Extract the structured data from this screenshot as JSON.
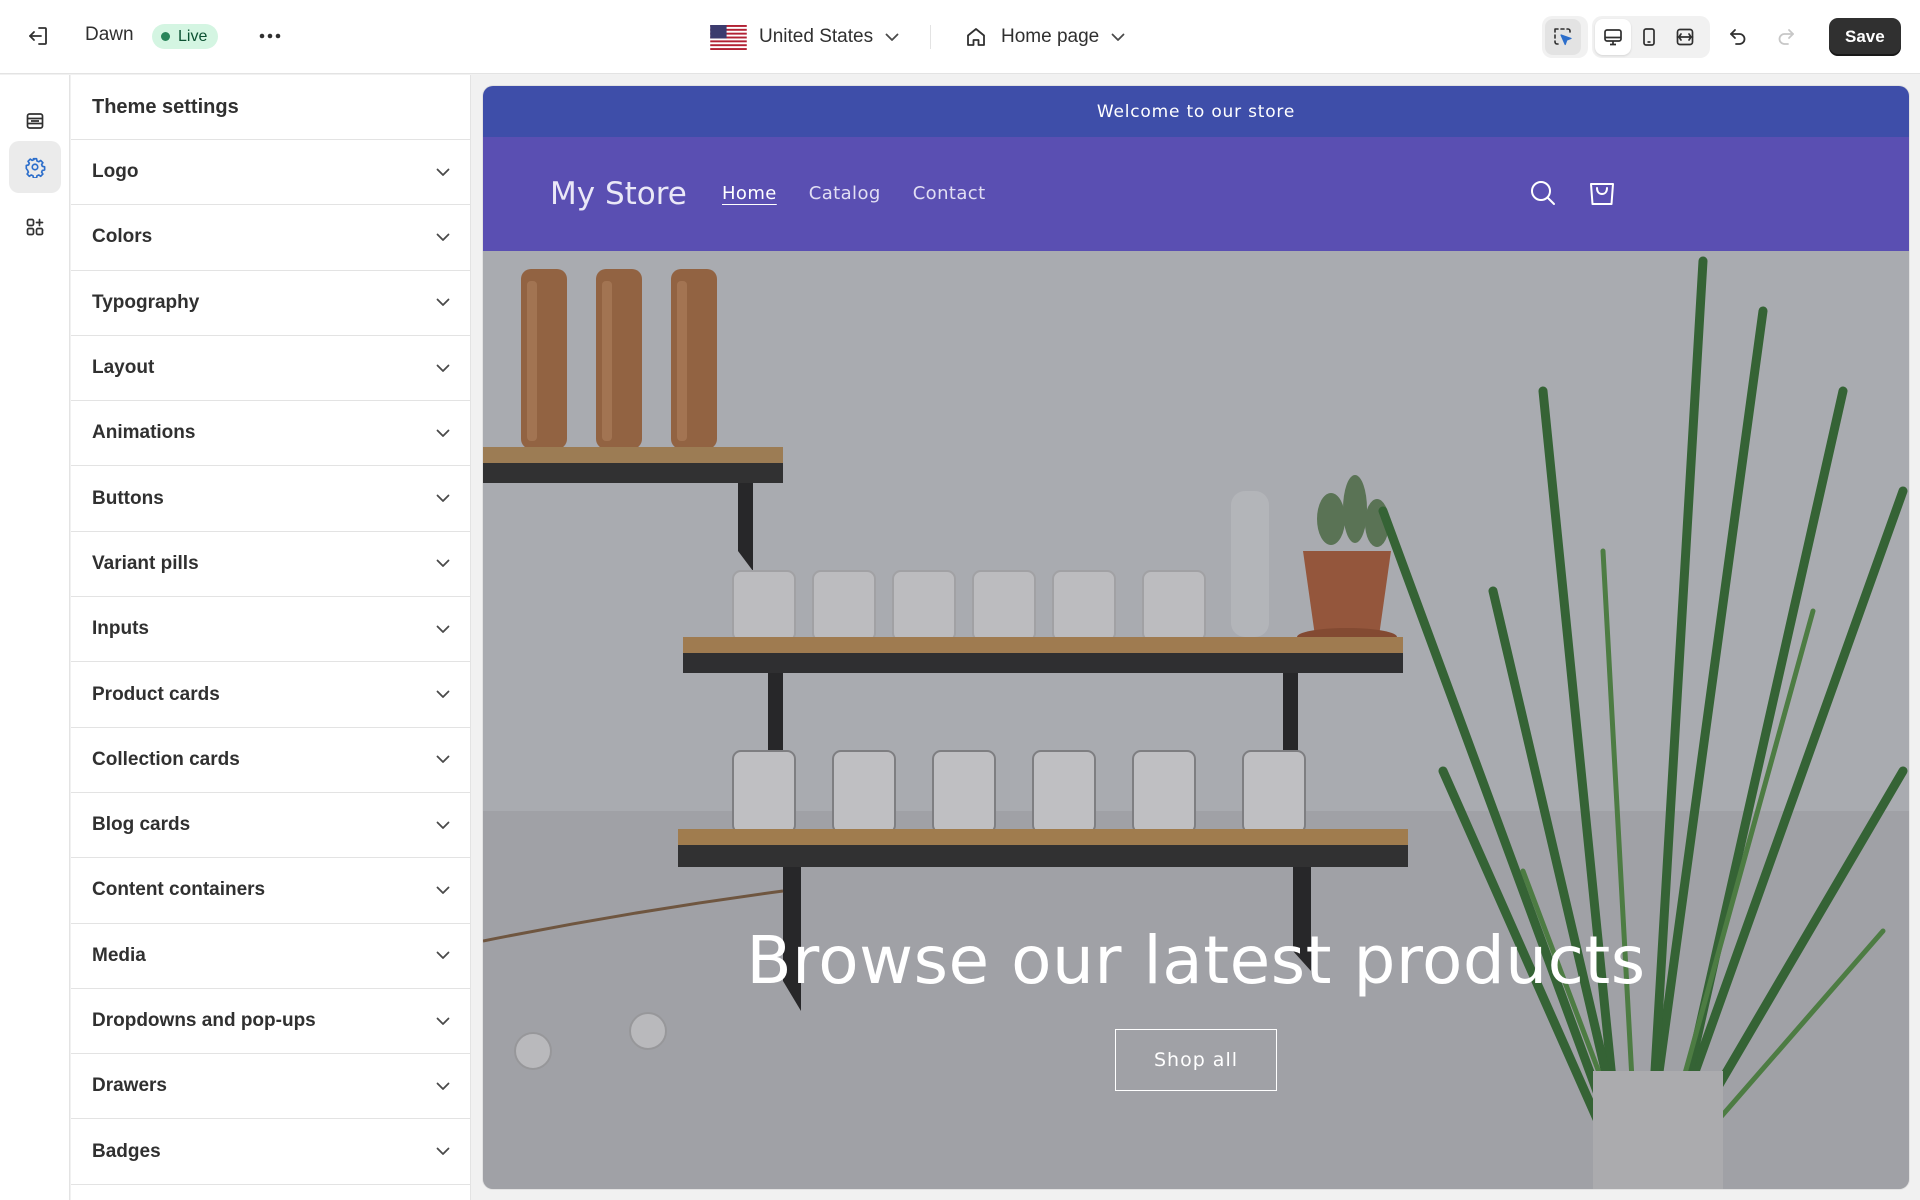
{
  "topbar": {
    "theme_name": "Dawn",
    "status_badge": "Live",
    "country": "United States",
    "page": "Home page",
    "save_label": "Save"
  },
  "icons": {
    "exit": "exit-icon",
    "more": "more-horizontal-icon",
    "flag": "us-flag-icon",
    "home": "home-icon",
    "chevron": "chevron-down-icon",
    "inspector": "select-cursor-icon",
    "desktop": "desktop-icon",
    "mobile": "mobile-icon",
    "full_width": "full-width-icon",
    "undo": "undo-icon",
    "redo": "redo-icon",
    "sections": "sections-icon",
    "theme_settings": "gear-icon",
    "apps": "apps-icon",
    "search": "search-icon",
    "cart": "cart-icon"
  },
  "colors": {
    "announcement_bar": "#3e4ea9",
    "store_header": "#5a4fb2",
    "live_badge": "#d4f5e2",
    "save_button": "#303030"
  },
  "panel": {
    "title": "Theme settings",
    "items": [
      {
        "label": "Logo"
      },
      {
        "label": "Colors"
      },
      {
        "label": "Typography"
      },
      {
        "label": "Layout"
      },
      {
        "label": "Animations"
      },
      {
        "label": "Buttons"
      },
      {
        "label": "Variant pills"
      },
      {
        "label": "Inputs"
      },
      {
        "label": "Product cards"
      },
      {
        "label": "Collection cards"
      },
      {
        "label": "Blog cards"
      },
      {
        "label": "Content containers"
      },
      {
        "label": "Media"
      },
      {
        "label": "Dropdowns and pop-ups"
      },
      {
        "label": "Drawers"
      },
      {
        "label": "Badges"
      }
    ]
  },
  "preview": {
    "announcement": "Welcome to our store",
    "store_name": "My Store",
    "nav": [
      {
        "label": "Home"
      },
      {
        "label": "Catalog"
      },
      {
        "label": "Contact"
      }
    ],
    "hero_title": "Browse our latest products",
    "hero_button": "Shop all"
  }
}
